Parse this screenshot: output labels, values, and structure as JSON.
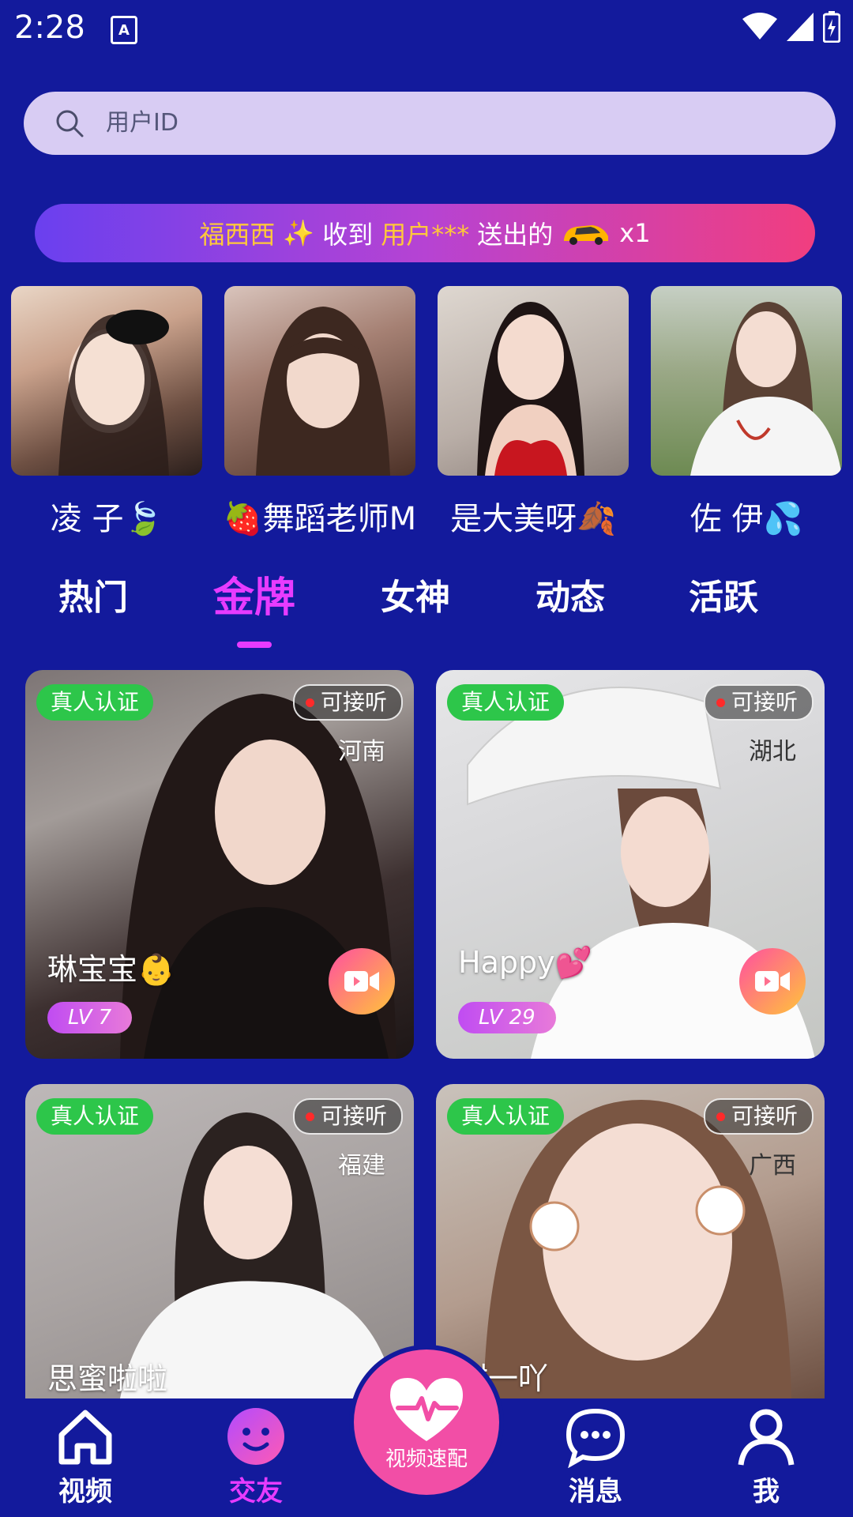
{
  "status_bar": {
    "time": "2:28",
    "notification_letter": "A"
  },
  "search": {
    "placeholder": "用户ID"
  },
  "gift_banner": {
    "sender": "福西西",
    "received_text": "收到",
    "from_user": "用户***",
    "sent_text": "送出的",
    "multiplier": "x1"
  },
  "featured": [
    {
      "name": "凌 子🍃"
    },
    {
      "name": "🍓舞蹈老师M"
    },
    {
      "name": "是大美呀🍂"
    },
    {
      "name": "佐 伊💦"
    }
  ],
  "tabs": [
    {
      "label": "热门"
    },
    {
      "label": "金牌"
    },
    {
      "label": "女神"
    },
    {
      "label": "动态"
    },
    {
      "label": "活跃"
    }
  ],
  "active_tab": "金牌",
  "cards": [
    {
      "verified": "真人认证",
      "status": "可接听",
      "region": "河南",
      "nickname": "琳宝宝👶",
      "level": "LV 7"
    },
    {
      "verified": "真人认证",
      "status": "可接听",
      "region": "湖北",
      "nickname": "Happy💕",
      "level": "LV 29"
    },
    {
      "verified": "真人认证",
      "status": "可接听",
      "region": "福建",
      "nickname": "思蜜啦啦"
    },
    {
      "verified": "真人认证",
      "status": "可接听",
      "region": "广西",
      "nickname": "甜一吖"
    }
  ],
  "bottom_nav": {
    "video": "视频",
    "friends": "交友",
    "match": "视频速配",
    "messages": "消息",
    "me": "我"
  },
  "colors": {
    "background": "#131a9c",
    "accent": "#e73bff",
    "verified": "#2dc64a",
    "match_button": "#f24ea6"
  }
}
